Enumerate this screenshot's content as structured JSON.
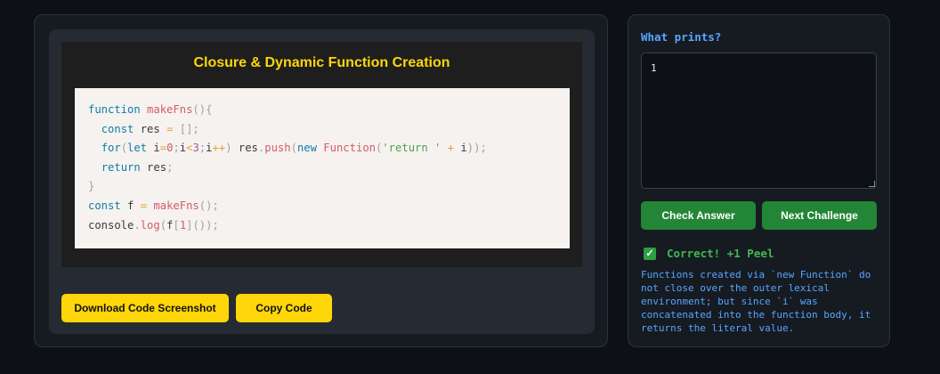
{
  "snippet": {
    "title": "Closure & Dynamic Function Creation",
    "code_lines": [
      "function makeFns(){",
      "  const res = [];",
      "  for(let i=0;i<3;i++) res.push(new Function('return ' + i));",
      "  return res;",
      "}",
      "const f = makeFns();",
      "console.log(f[1]());"
    ]
  },
  "actions": {
    "download_label": "Download Code Screenshot",
    "copy_label": "Copy Code"
  },
  "quiz": {
    "question": "What prints?",
    "answer_value": "1",
    "check_label": "Check Answer",
    "next_label": "Next Challenge",
    "result_text": "Correct! +1 Peel",
    "explanation": "Functions created via `new Function` do not close over the outer lexical environment; but since `i` was concatenated into the function body, it returns the literal value."
  },
  "colors": {
    "accent_yellow": "#ffd60a",
    "accent_green": "#238636",
    "link_blue": "#58a6ff",
    "success_green": "#3fb950"
  }
}
